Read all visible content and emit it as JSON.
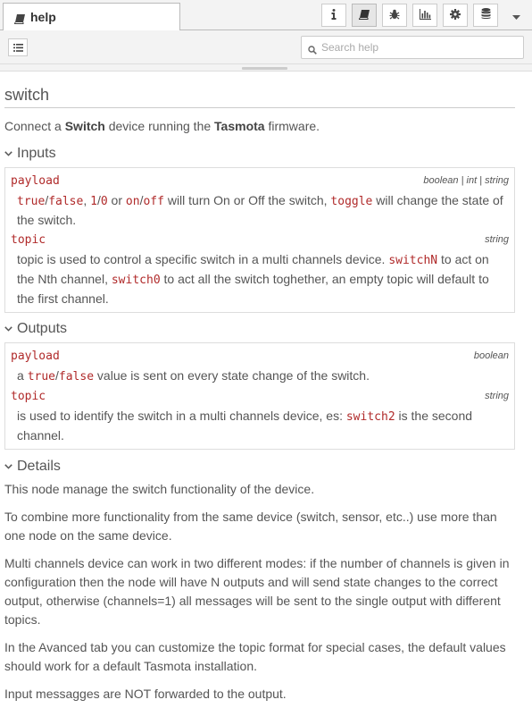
{
  "header": {
    "tab_label": "help",
    "icons": [
      "book-icon",
      "info-icon",
      "book-icon",
      "bug-icon",
      "bar-chart-icon",
      "gear-icon",
      "database-icon",
      "caret-down-icon"
    ]
  },
  "toolbar": {
    "search_placeholder": "Search help"
  },
  "page": {
    "title": "switch",
    "intro": {
      "before": "Connect a ",
      "switch": "Switch",
      "middle": " device running the ",
      "tasmota": "Tasmota",
      "after": " firmware."
    }
  },
  "inputs": {
    "heading": "Inputs",
    "props": [
      {
        "name": "payload",
        "type": "boolean | int | string",
        "parts": [
          {
            "code": "true"
          },
          {
            "t": "/"
          },
          {
            "code": "false"
          },
          {
            "t": ", "
          },
          {
            "code": "1"
          },
          {
            "t": "/"
          },
          {
            "code": "0"
          },
          {
            "t": " or "
          },
          {
            "code": "on"
          },
          {
            "t": "/"
          },
          {
            "code": "off"
          },
          {
            "t": " will turn On or Off the switch, "
          },
          {
            "code": "toggle"
          },
          {
            "t": " will change the state of the switch."
          }
        ]
      },
      {
        "name": "topic",
        "type": "string",
        "parts": [
          {
            "t": "topic is used to control a specific switch in a multi channels device. "
          },
          {
            "code": "switchN"
          },
          {
            "t": " to act on the Nth channel, "
          },
          {
            "code": "switch0"
          },
          {
            "t": " to act all the switch toghether, an empty topic will default to the first channel."
          }
        ]
      }
    ]
  },
  "outputs": {
    "heading": "Outputs",
    "props": [
      {
        "name": "payload",
        "type": "boolean",
        "parts": [
          {
            "t": "a "
          },
          {
            "code": "true"
          },
          {
            "t": "/"
          },
          {
            "code": "false"
          },
          {
            "t": " value is sent on every state change of the switch."
          }
        ]
      },
      {
        "name": "topic",
        "type": "string",
        "parts": [
          {
            "t": "is used to identify the switch in a multi channels device, es: "
          },
          {
            "code": "switch2"
          },
          {
            "t": " is the second channel."
          }
        ]
      }
    ]
  },
  "details": {
    "heading": "Details",
    "paragraphs": [
      "This node manage the switch functionality of the device.",
      "To combine more functionality from the same device (switch, sensor, etc..) use more than one node on the same device.",
      "Multi channels device can work in two different modes: if the number of channels is given in configuration then the node will have N outputs and will send state changes to the correct output, otherwise (channels=1) all messages will be sent to the single output with different topics.",
      "In the Avanced tab you can customize the topic format for special cases, the default values should work for a default Tasmota installation.",
      "Input messagges are NOT forwarded to the output."
    ]
  }
}
